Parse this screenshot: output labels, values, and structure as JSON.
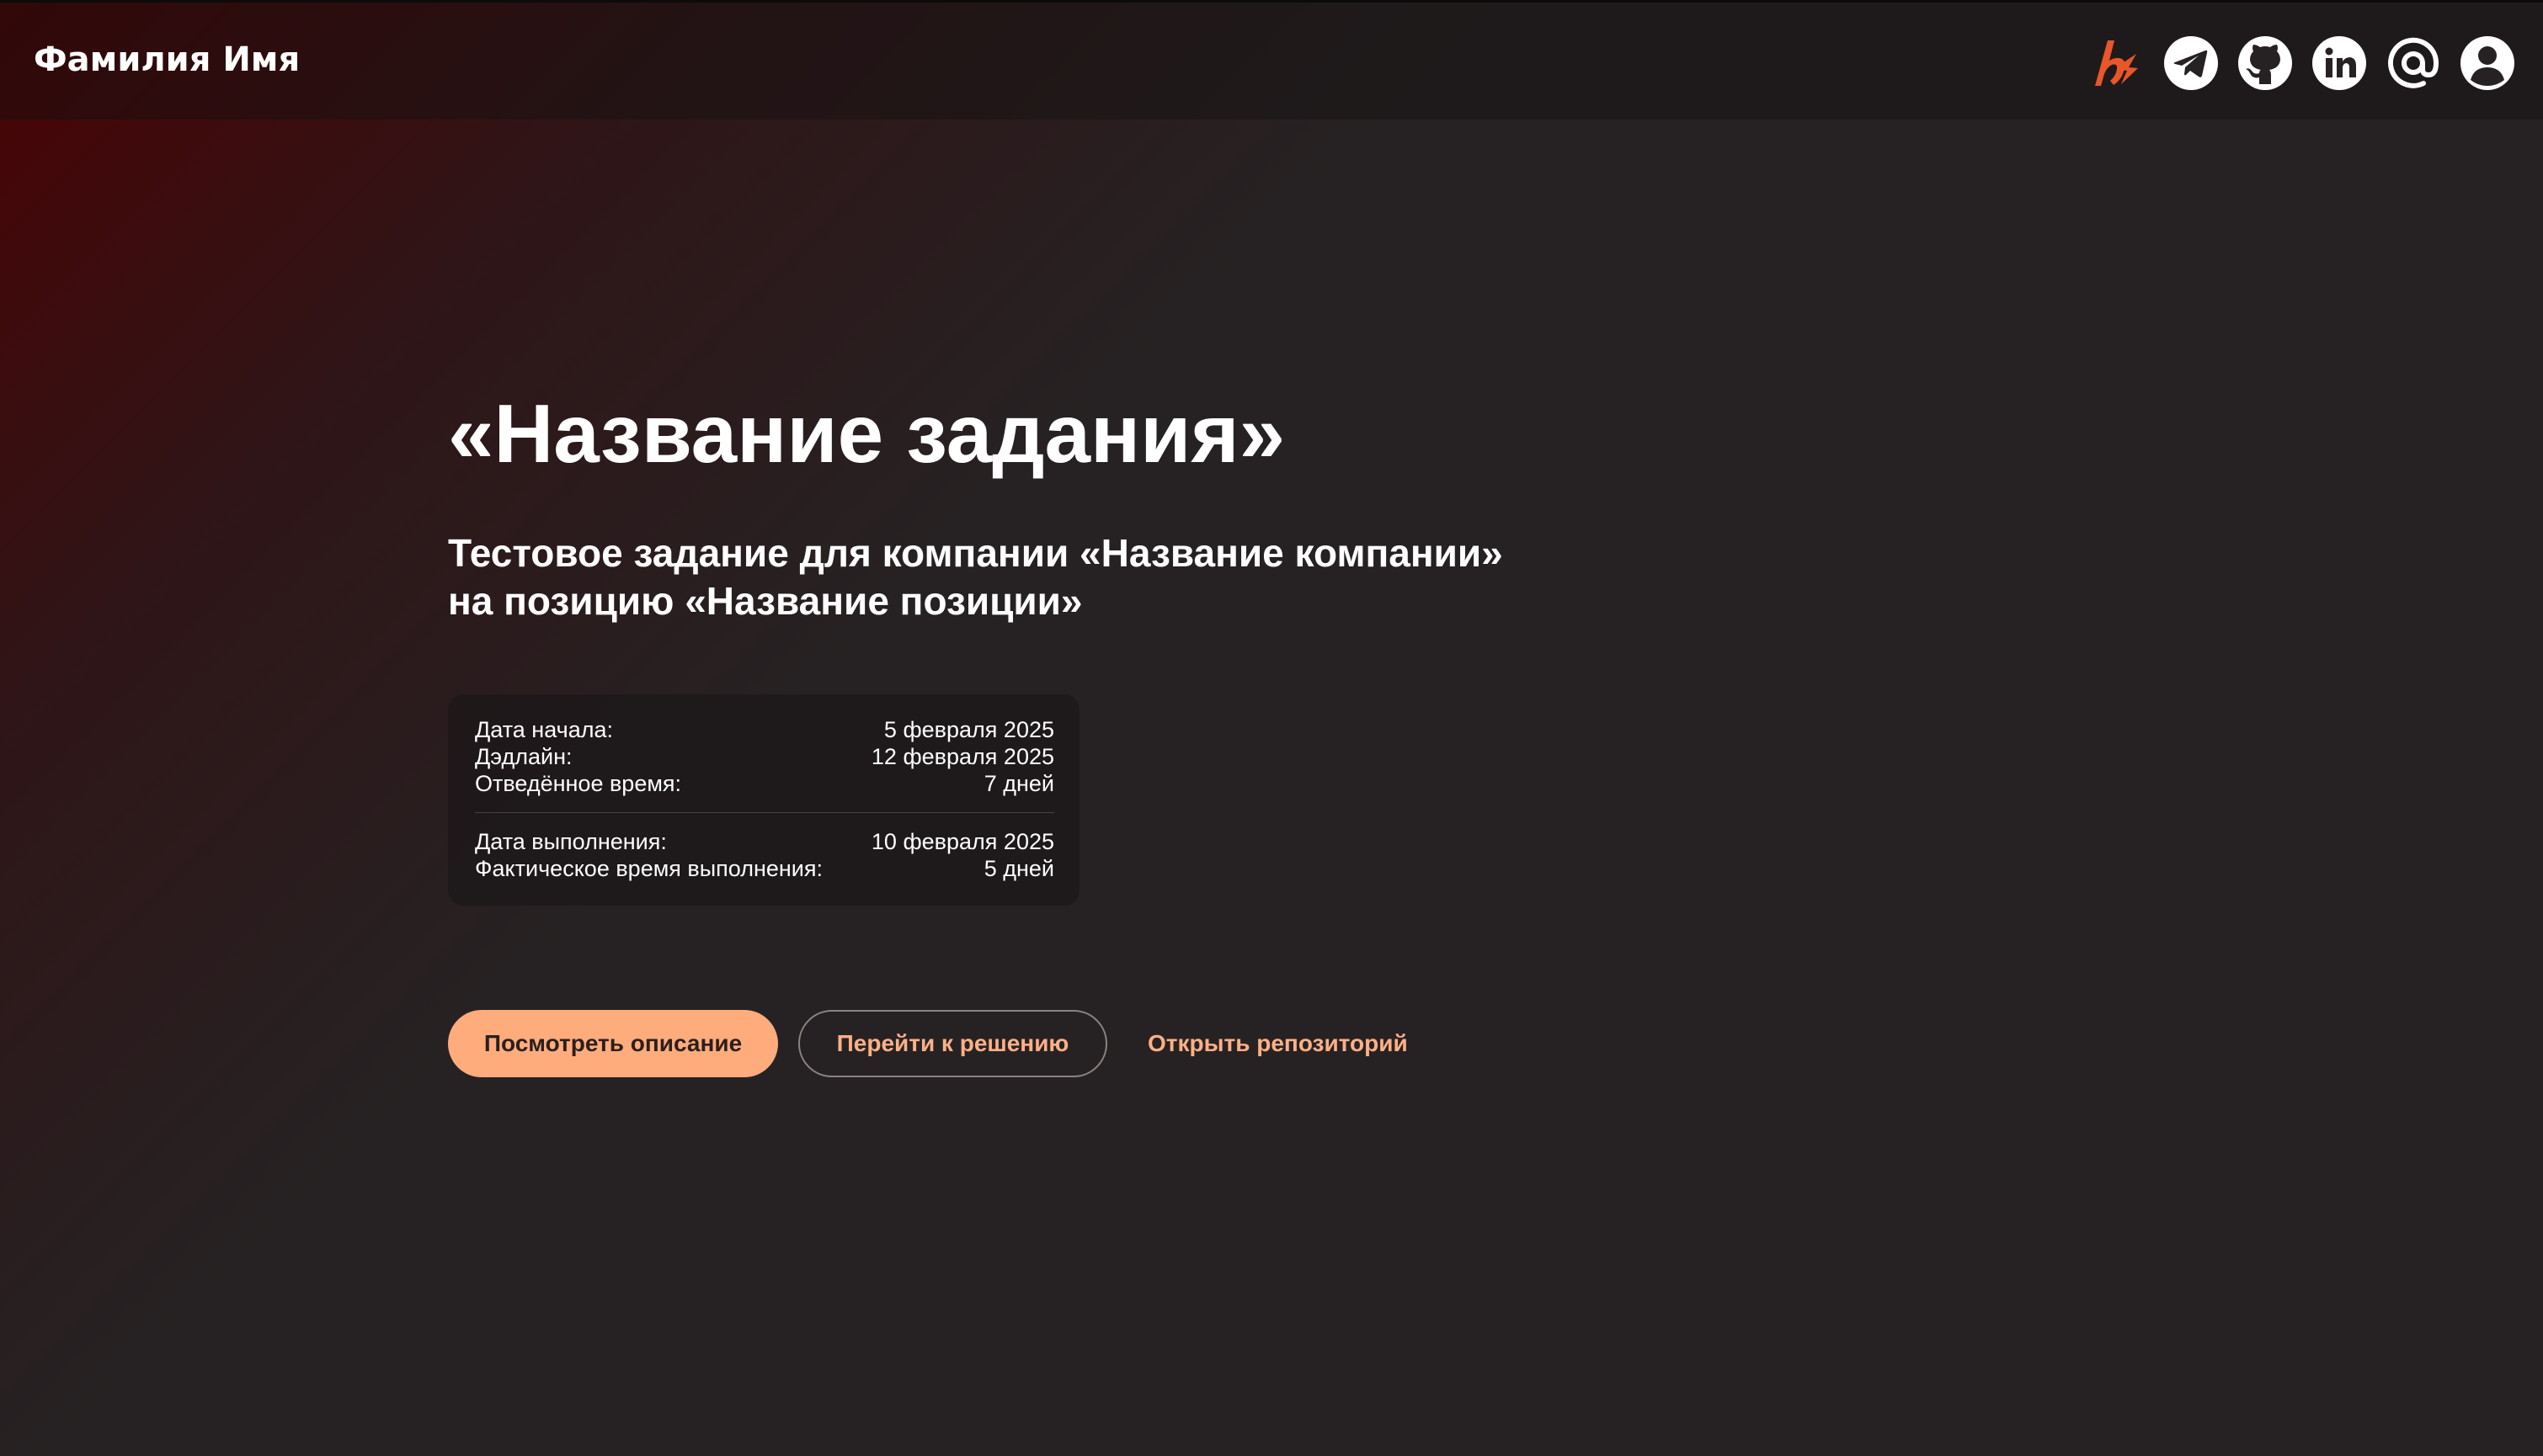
{
  "header": {
    "brand": "Фамилия Имя",
    "icons": [
      {
        "name": "habr-icon",
        "color": "#e8562a"
      },
      {
        "name": "telegram-icon"
      },
      {
        "name": "github-icon"
      },
      {
        "name": "linkedin-icon"
      },
      {
        "name": "email-at-icon"
      },
      {
        "name": "profile-icon"
      }
    ]
  },
  "main": {
    "title": "«Название задания»",
    "subtitle_line1": "Тестовое задание для компании «Название компании»",
    "subtitle_line2": "на позицию «Название позиции»",
    "info": {
      "start_label": "Дата начала:",
      "start_value": "5 февраля 2025",
      "deadline_label": "Дэдлайн:",
      "deadline_value": "12 февраля 2025",
      "allotted_label": "Отведённое время:",
      "allotted_value": "7 дней",
      "done_label": "Дата выполнения:",
      "done_value": "10 февраля 2025",
      "actual_label": "Фактическое время выполнения:",
      "actual_value": "5 дней"
    },
    "actions": {
      "view_description": "Посмотреть описание",
      "go_to_solution": "Перейти к решению",
      "open_repository": "Открыть репозиторий"
    }
  },
  "colors": {
    "background": "#262223",
    "accent": "#ffac7c",
    "accent_text": "#ffb086",
    "gradient_red": "#4a0204"
  }
}
